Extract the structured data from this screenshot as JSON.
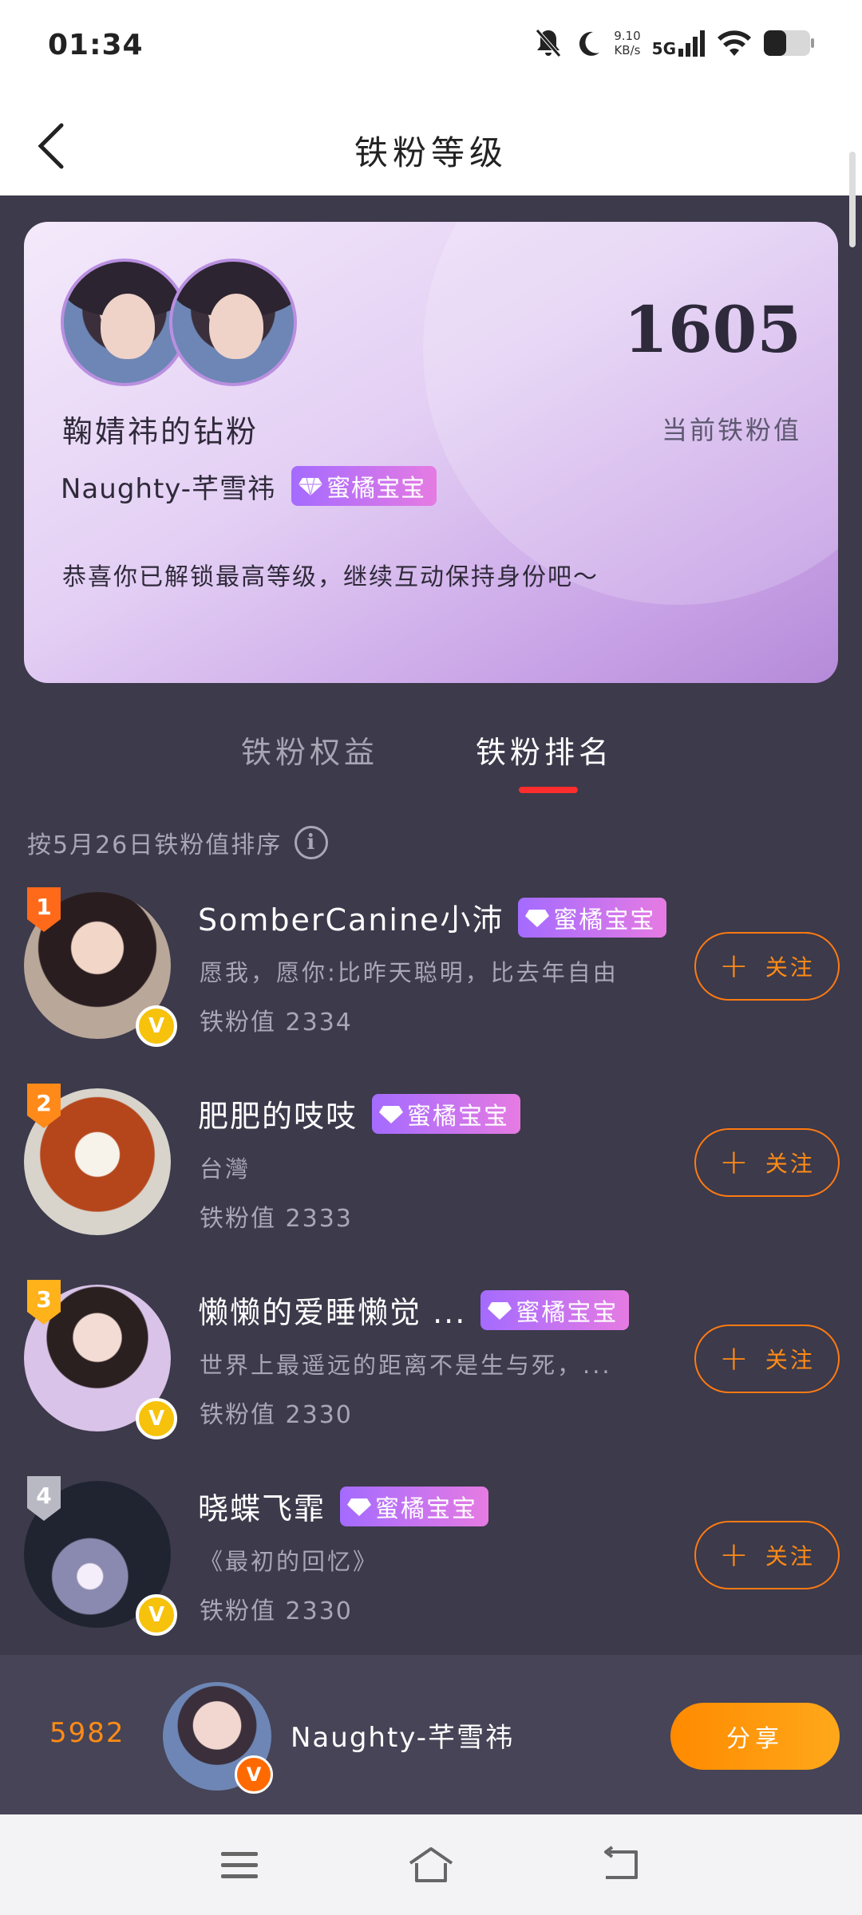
{
  "status_bar": {
    "time": "01:34",
    "net_speed_value": "9.10",
    "net_speed_unit": "KB/s",
    "network": "5G"
  },
  "header": {
    "title": "铁粉等级"
  },
  "fan_card": {
    "value": "1605",
    "value_label": "当前铁粉值",
    "fan_title": "鞠婧祎的钻粉",
    "username": "Naughty-芊雪祎",
    "badge_label": "蜜橘宝宝",
    "message": "恭喜你已解锁最高等级，继续互动保持身份吧～"
  },
  "tabs": [
    {
      "label": "铁粉权益"
    },
    {
      "label": "铁粉排名"
    }
  ],
  "sort_note": "按5月26日铁粉值排序",
  "ranking": [
    {
      "rank": "1",
      "name": "SomberCanine小沛",
      "badge": "蜜橘宝宝",
      "signature": "愿我，愿你:比昨天聪明，比去年自由",
      "value_text": "铁粉值 2334",
      "follow": "关注"
    },
    {
      "rank": "2",
      "name": "肥肥的吱吱",
      "badge": "蜜橘宝宝",
      "signature": "台灣",
      "value_text": "铁粉值 2333",
      "follow": "关注"
    },
    {
      "rank": "3",
      "name": "懒懒的爱睡懒觉 ...",
      "badge": "蜜橘宝宝",
      "signature": "世界上最遥远的距离不是生与死，...",
      "value_text": "铁粉值 2330",
      "follow": "关注"
    },
    {
      "rank": "4",
      "name": "晓蝶飞霏",
      "badge": "蜜橘宝宝",
      "signature": "《最初的回忆》",
      "value_text": "铁粉值 2330",
      "follow": "关注"
    }
  ],
  "bottom_bar": {
    "score": "5982",
    "name": "Naughty-芊雪祎",
    "share_label": "分享"
  },
  "colors": {
    "accent": "#ff8b16",
    "tab_indicator": "#ff2d2d",
    "badge_start": "#a46bff",
    "badge_end": "#e67be2",
    "background": "#3c3a4b"
  },
  "icons": {
    "back": "chevron-left-icon",
    "info": "info-icon",
    "menu": "menu-icon",
    "home": "home-icon",
    "return": "return-icon"
  }
}
